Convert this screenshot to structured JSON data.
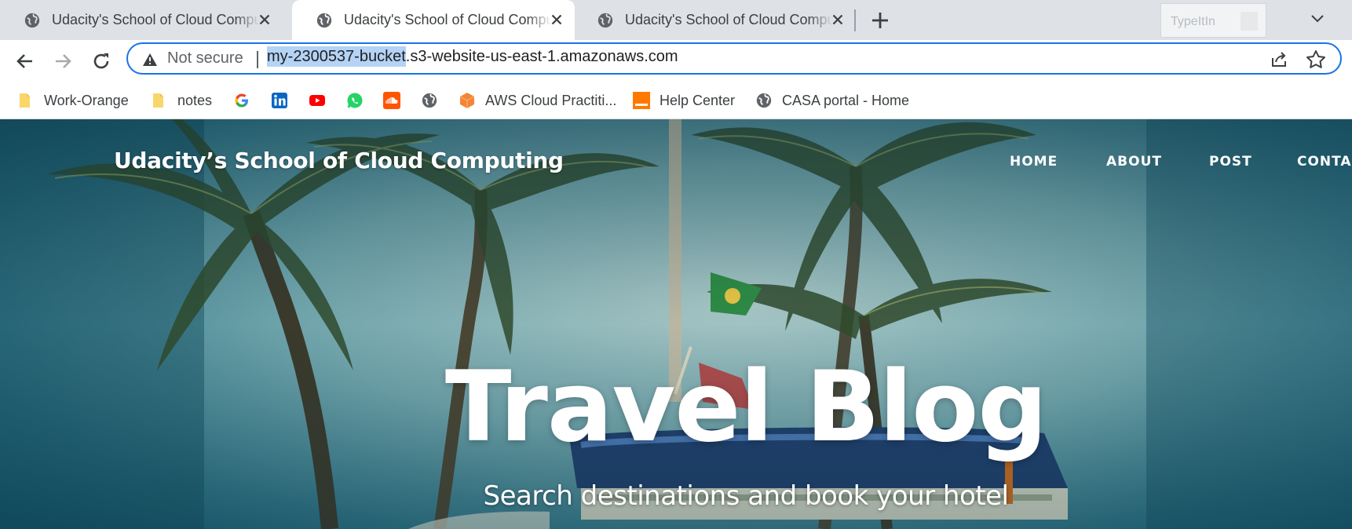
{
  "browser": {
    "tabs": [
      {
        "title": "Udacity's School of Cloud Computing",
        "active": false
      },
      {
        "title": "Udacity's School of Cloud Computing",
        "active": true
      },
      {
        "title": "Udacity's School of Cloud Computing",
        "active": false
      }
    ],
    "extension_label": "TypeItIn",
    "security_label": "Not secure",
    "url_highlighted": "my-2300537-bucket",
    "url_rest": ".s3-website-us-east-1.amazonaws.com",
    "accent_color": "#1a73e8",
    "bookmarks": [
      {
        "label": "Work-Orange",
        "icon": "folder-icon"
      },
      {
        "label": "notes",
        "icon": "folder-icon"
      },
      {
        "label": "",
        "icon": "google-icon"
      },
      {
        "label": "",
        "icon": "linkedin-icon"
      },
      {
        "label": "",
        "icon": "youtube-icon"
      },
      {
        "label": "",
        "icon": "whatsapp-icon"
      },
      {
        "label": "",
        "icon": "soundcloud-icon"
      },
      {
        "label": "",
        "icon": "globe-icon"
      },
      {
        "label": "AWS Cloud Practiti...",
        "icon": "aws-box-icon"
      },
      {
        "label": "Help Center",
        "icon": "orange-icon"
      },
      {
        "label": "CASA portal - Home",
        "icon": "globe-icon"
      }
    ]
  },
  "site": {
    "brand": "Udacity’s School of Cloud Computing",
    "nav": [
      "HOME",
      "ABOUT",
      "POST",
      "CONTA"
    ],
    "hero_title": "Travel Blog",
    "hero_subtitle": "Search destinations and book your hotel"
  }
}
